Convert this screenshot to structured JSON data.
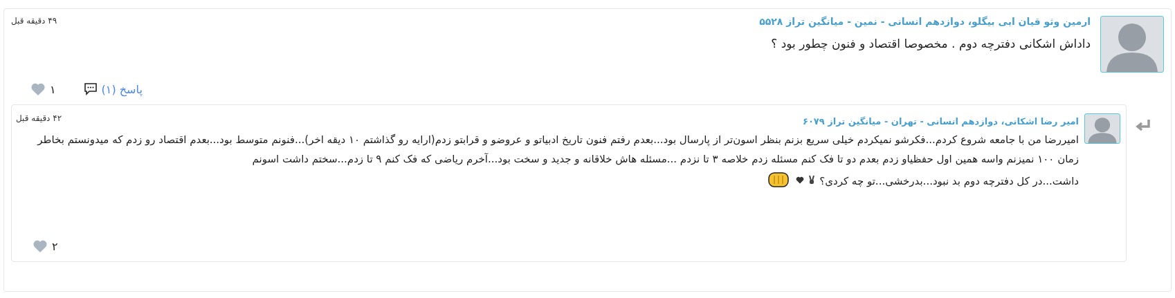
{
  "comment": {
    "author": "ارمین وثو قیان ابی بیگلو، دوازدهم انسانی - نمین - میانگین تراز ۵۵۲۸",
    "time": "۴۹ دقیقه قبل",
    "body": "داداش اشکانی دفترچه دوم . مخصوصا اقتصاد و فنون چطور بود ؟",
    "likes": "۱",
    "liked": false,
    "reply_link": "پاسخ (۱)"
  },
  "replies": [
    {
      "author": "امیر رضا اشکانی، دوازدهم انسانی - تهران - میانگین تراز ۶۰۷۹",
      "time": "۴۲ دقیقه قبل",
      "paragraphs": [
        "امیررضا من با جامعه شروع کردم...فکرشو نمیکردم خیلی سریع بزنم بنظر اسون‌تر از پارسال بود...بعدم رفتم فنون تاریخ ادبیاتو و عروضو و قرابتو زدم(ارایه رو گذاشتم ۱۰ دیقه اخر)...فنونم متوسط بود...بعدم اقتصاد رو زدم که میدونستم بخاطر زمان ۱۰۰ نمیزنم واسه همین اول حفظیاو زدم بعدم دو تا فک کنم مسئله زدم خلاصه ۳ تا نزدم ...مسئله هاش خلاقانه و جدید و سخت بود...آخرم ریاضی که فک کنم ۹ تا زدم...سختم داشت اسونم",
        "داشت...در کل دفترچه دوم بد نبود...بدرخشی...تو چه کردی؟"
      ],
      "likes": "۲",
      "liked": false
    }
  ]
}
